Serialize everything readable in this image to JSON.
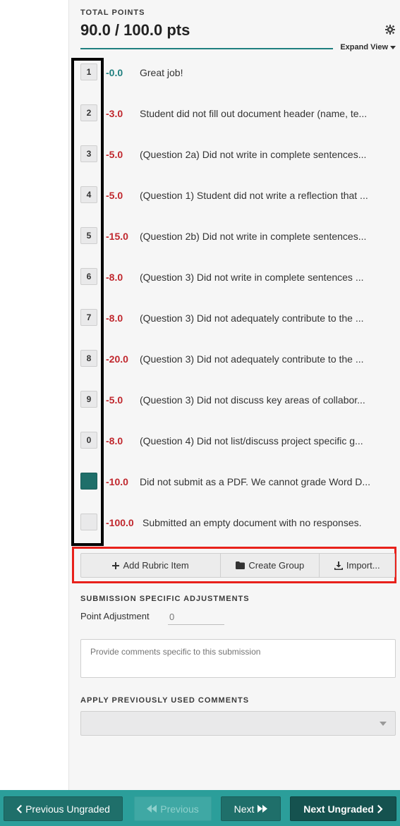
{
  "header": {
    "total_label": "TOTAL POINTS",
    "total_value": "90.0 / 100.0 pts",
    "expand_view": "Expand View"
  },
  "rubric": [
    {
      "key": "1",
      "points": "-0.0",
      "description": "Great job!",
      "state": "key"
    },
    {
      "key": "2",
      "points": "-3.0",
      "description": "Student did not fill out document header (name, te...",
      "state": "key"
    },
    {
      "key": "3",
      "points": "-5.0",
      "description": "(Question 2a) Did not write in complete sentences...",
      "state": "key"
    },
    {
      "key": "4",
      "points": "-5.0",
      "description": "(Question 1) Student did not write a reflection that ...",
      "state": "key"
    },
    {
      "key": "5",
      "points": "-15.0",
      "description": "(Question 2b) Did not write in complete sentences...",
      "state": "key"
    },
    {
      "key": "6",
      "points": "-8.0",
      "description": "(Question 3) Did not write in complete sentences ...",
      "state": "key"
    },
    {
      "key": "7",
      "points": "-8.0",
      "description": "(Question 3) Did not adequately contribute to the ...",
      "state": "key"
    },
    {
      "key": "8",
      "points": "-20.0",
      "description": "(Question 3) Did not adequately contribute to the ...",
      "state": "key"
    },
    {
      "key": "9",
      "points": "-5.0",
      "description": "(Question 3) Did not discuss key areas of collabor...",
      "state": "key"
    },
    {
      "key": "0",
      "points": "-8.0",
      "description": "(Question 4) Did not list/discuss project specific g...",
      "state": "key"
    },
    {
      "key": "",
      "points": "-10.0",
      "description": "Did not submit as a PDF. We cannot grade Word D...",
      "state": "filled"
    },
    {
      "key": "",
      "points": "-100.0",
      "description": "Submitted an empty document with no responses.",
      "state": "empty"
    }
  ],
  "actions": {
    "add_rubric_item": "Add Rubric Item",
    "create_group": "Create Group",
    "import": "Import..."
  },
  "adjustments": {
    "title": "SUBMISSION SPECIFIC ADJUSTMENTS",
    "point_label": "Point Adjustment",
    "point_value": "0",
    "comment_placeholder": "Provide comments specific to this submission"
  },
  "previous_comments": {
    "title": "APPLY PREVIOUSLY USED COMMENTS",
    "selected": ""
  },
  "footer": {
    "previous_ungraded": "Previous Ungraded",
    "previous": "Previous",
    "next": "Next",
    "next_ungraded": "Next Ungraded"
  },
  "colors": {
    "teal": "#1f7f7f",
    "deduction_red": "#c0272d",
    "footer_bg": "#2b9e9a",
    "highlight_red": "#e8211b"
  }
}
